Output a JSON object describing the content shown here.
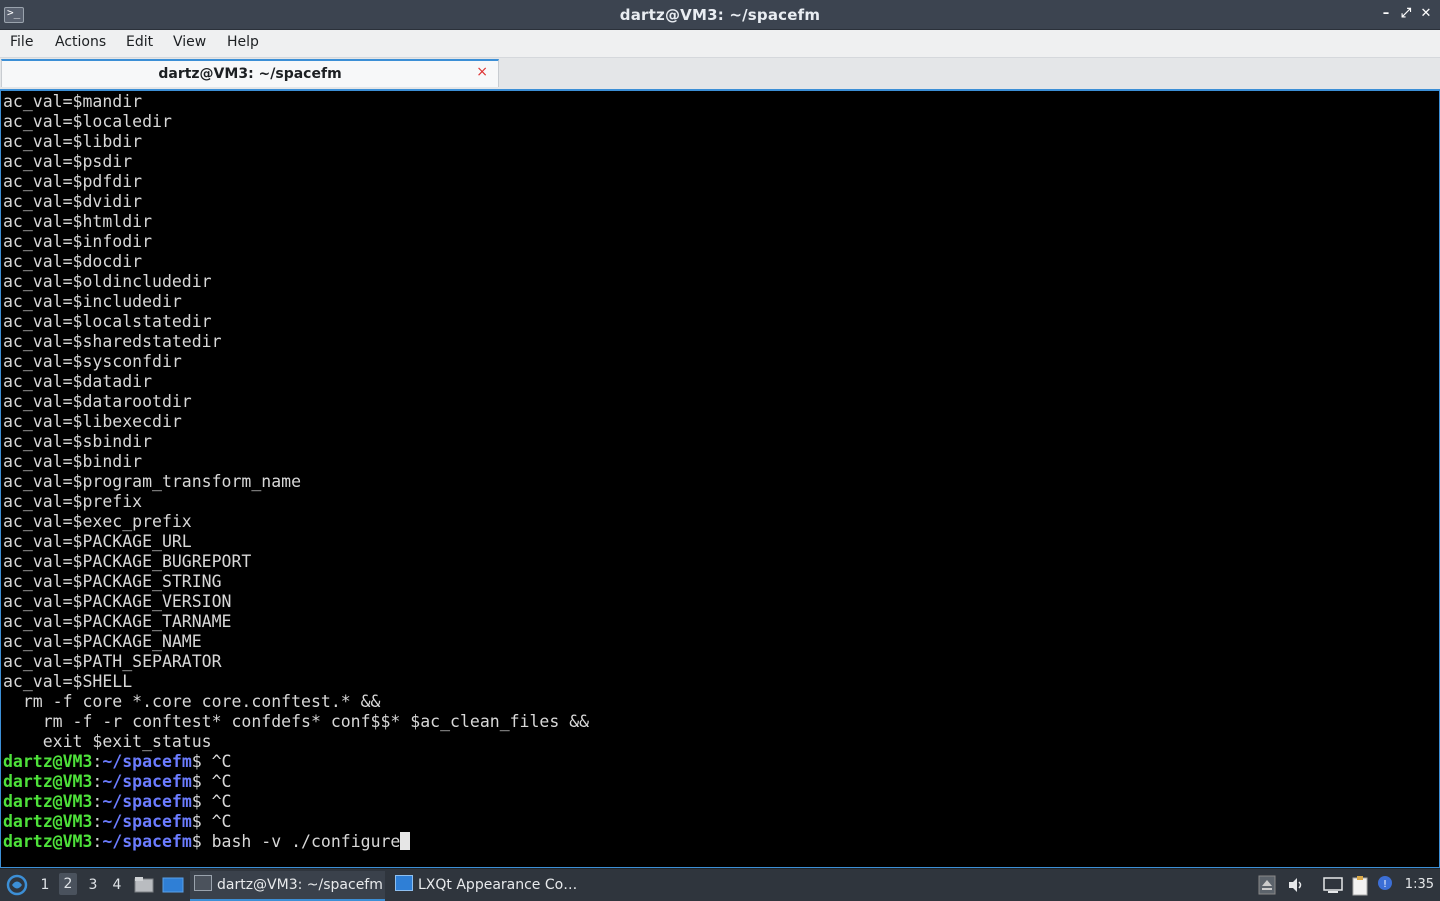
{
  "window": {
    "title": "dartz@VM3: ~/spacefm",
    "icon": "terminal-icon",
    "controls": [
      "minimize-icon",
      "maximize-icon",
      "close-icon"
    ]
  },
  "menu": [
    "File",
    "Actions",
    "Edit",
    "View",
    "Help"
  ],
  "tabs": [
    {
      "label": "dartz@VM3: ~/spacefm",
      "close_glyph": "×"
    }
  ],
  "terminal": {
    "output_lines": [
      "ac_val=$mandir",
      "ac_val=$localedir",
      "ac_val=$libdir",
      "ac_val=$psdir",
      "ac_val=$pdfdir",
      "ac_val=$dvidir",
      "ac_val=$htmldir",
      "ac_val=$infodir",
      "ac_val=$docdir",
      "ac_val=$oldincludedir",
      "ac_val=$includedir",
      "ac_val=$localstatedir",
      "ac_val=$sharedstatedir",
      "ac_val=$sysconfdir",
      "ac_val=$datadir",
      "ac_val=$datarootdir",
      "ac_val=$libexecdir",
      "ac_val=$sbindir",
      "ac_val=$bindir",
      "ac_val=$program_transform_name",
      "ac_val=$prefix",
      "ac_val=$exec_prefix",
      "ac_val=$PACKAGE_URL",
      "ac_val=$PACKAGE_BUGREPORT",
      "ac_val=$PACKAGE_STRING",
      "ac_val=$PACKAGE_VERSION",
      "ac_val=$PACKAGE_TARNAME",
      "ac_val=$PACKAGE_NAME",
      "ac_val=$PATH_SEPARATOR",
      "ac_val=$SHELL",
      "  rm -f core *.core core.conftest.* &&",
      "    rm -f -r conftest* confdefs* conf$$* $ac_clean_files &&",
      "    exit $exit_status"
    ],
    "prompt_user": "dartz@VM3",
    "prompt_sep": ":",
    "prompt_path": "~/spacefm",
    "prompt_end": "$ ",
    "prompt_lines": [
      "^C",
      "^C",
      "^C",
      "^C",
      "bash -v ./configure"
    ]
  },
  "taskbar": {
    "start_icon": "lxqt-menu-icon",
    "desktops": [
      "1",
      "2",
      "3",
      "4"
    ],
    "active_desktop": "2",
    "quicklaunch": [
      "file-manager-icon",
      "show-desktop-icon"
    ],
    "tasks": [
      {
        "label": "dartz@VM3: ~/spacefm",
        "icon": "terminal-icon",
        "active": true
      },
      {
        "label": "LXQt Appearance Co…",
        "icon": "appearance-icon",
        "active": false
      }
    ],
    "tray": [
      "eject-icon",
      "volume-icon",
      "network-icon",
      "clipboard-icon",
      "notification-icon"
    ],
    "clock": "1:35"
  },
  "colors": {
    "prompt_user": "#4ee23a",
    "prompt_path": "#6b7cff",
    "accent": "#3c8fd6"
  }
}
